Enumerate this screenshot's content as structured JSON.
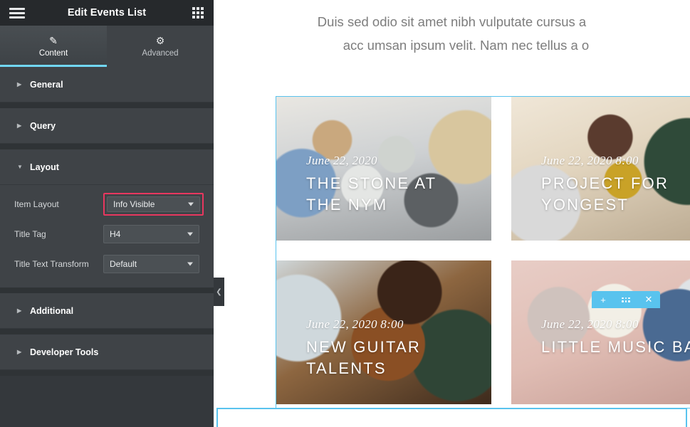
{
  "panel": {
    "title": "Edit Events List",
    "menu_icon": "hamburger-menu-icon",
    "apps_icon": "apps-grid-icon",
    "collapse_icon": "chevron-left-icon",
    "tabs": [
      {
        "label": "Content",
        "icon": "pencil-icon",
        "glyph": "✎",
        "active": true
      },
      {
        "label": "Advanced",
        "icon": "gear-icon",
        "glyph": "⚙",
        "active": false
      }
    ],
    "sections": [
      {
        "label": "General",
        "open": false
      },
      {
        "label": "Query",
        "open": false
      },
      {
        "label": "Layout",
        "open": true
      },
      {
        "label": "Additional",
        "open": false
      },
      {
        "label": "Developer Tools",
        "open": false
      }
    ],
    "layout_fields": [
      {
        "label": "Item Layout",
        "value": "Info Visible",
        "highlighted": true
      },
      {
        "label": "Title Tag",
        "value": "H4",
        "highlighted": false
      },
      {
        "label": "Title Text Transform",
        "value": "Default",
        "highlighted": false
      }
    ]
  },
  "canvas": {
    "intro_line1": "Duis sed odio sit amet nibh vulputate cursus a",
    "intro_line2": "acc umsan ipsum velit. Nam nec tellus a o",
    "cards": [
      {
        "date": "June 22, 2020",
        "title": "The Stone at the Nym"
      },
      {
        "date": "June 22, 2020 8:00",
        "title": "Project for Yongest"
      },
      {
        "date": "June 22, 2020 8:00",
        "title": "New Guitar Talents"
      },
      {
        "date": "June 22, 2020 8:00",
        "title": "Little Music Band"
      }
    ],
    "element_toolbar": [
      {
        "icon": "plus-icon",
        "glyph": "+"
      },
      {
        "icon": "drag-handle-icon",
        "glyph": ""
      },
      {
        "icon": "close-icon",
        "glyph": "✕"
      }
    ]
  },
  "colors": {
    "accent_blue": "#59c3ee",
    "highlight_pink": "#e8375f",
    "panel_bg": "#34383c",
    "panel_section_bg": "#3f4347",
    "panel_header_bg": "#26292c"
  }
}
